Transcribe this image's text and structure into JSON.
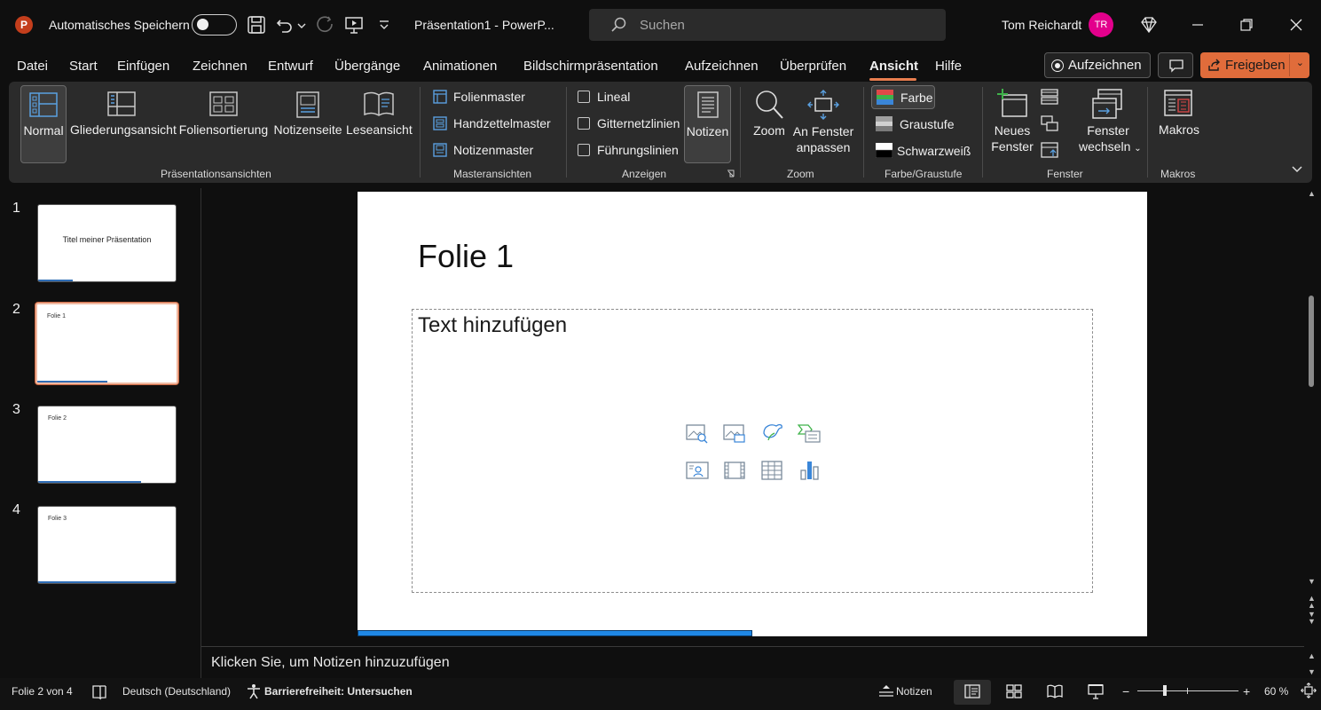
{
  "titlebar": {
    "app_logo": "P",
    "autosave_label": "Automatisches Speichern",
    "doc_title": "Präsentation1  -  PowerP...",
    "search_placeholder": "Suchen",
    "user_name": "Tom Reichardt",
    "avatar_initials": "TR"
  },
  "menu": {
    "tabs": [
      "Datei",
      "Start",
      "Einfügen",
      "Zeichnen",
      "Entwurf",
      "Übergänge",
      "Animationen",
      "Bildschirmpräsentation",
      "Aufzeichnen",
      "Überprüfen",
      "Ansicht",
      "Hilfe"
    ],
    "active_tab": "Ansicht",
    "record_label": "Aufzeichnen",
    "share_label": "Freigeben"
  },
  "ribbon": {
    "presentation_views": {
      "label": "Präsentationsansichten",
      "items": [
        "Normal",
        "Gliederungsansicht",
        "Foliensortierung",
        "Notizenseite",
        "Leseansicht"
      ]
    },
    "master_views": {
      "label": "Masteransichten",
      "items": [
        "Folienmaster",
        "Handzettelmaster",
        "Notizenmaster"
      ]
    },
    "show": {
      "label": "Anzeigen",
      "checkboxes": [
        "Lineal",
        "Gitternetzlinien",
        "Führungslinien"
      ],
      "notes_button": "Notizen"
    },
    "zoom": {
      "label": "Zoom",
      "zoom_button": "Zoom",
      "fit_line1": "An Fenster",
      "fit_line2": "anpassen"
    },
    "color": {
      "label": "Farbe/Graustufe",
      "items": [
        "Farbe",
        "Graustufe",
        "Schwarzweiß"
      ]
    },
    "window": {
      "label": "Fenster",
      "new_line1": "Neues",
      "new_line2": "Fenster",
      "switch_line1": "Fenster",
      "switch_line2": "wechseln"
    },
    "macros": {
      "label": "Makros",
      "button": "Makros"
    }
  },
  "thumbnails": [
    {
      "number": "1",
      "title": "Titel meiner Präsentation",
      "progress": 0.25
    },
    {
      "number": "2",
      "title": "Folie 1",
      "progress": 0.5
    },
    {
      "number": "3",
      "title": "Folie 2",
      "progress": 0.75
    },
    {
      "number": "4",
      "title": "Folie 3",
      "progress": 1.0
    }
  ],
  "slide": {
    "title": "Folie 1",
    "placeholder_text": "Text hinzufügen",
    "progress": 0.5
  },
  "notes": {
    "placeholder": "Klicken Sie, um Notizen hinzuzufügen"
  },
  "status": {
    "slide_counter": "Folie 2 von 4",
    "language": "Deutsch (Deutschland)",
    "accessibility": "Barrierefreiheit: Untersuchen",
    "notes_label": "Notizen",
    "zoom_level": "60 %"
  },
  "colors": {
    "accent": "#e06c3b",
    "brand_powerpoint": "#c43e1c",
    "avatar": "#e3008c",
    "progress_bar": "#1f88e6"
  }
}
